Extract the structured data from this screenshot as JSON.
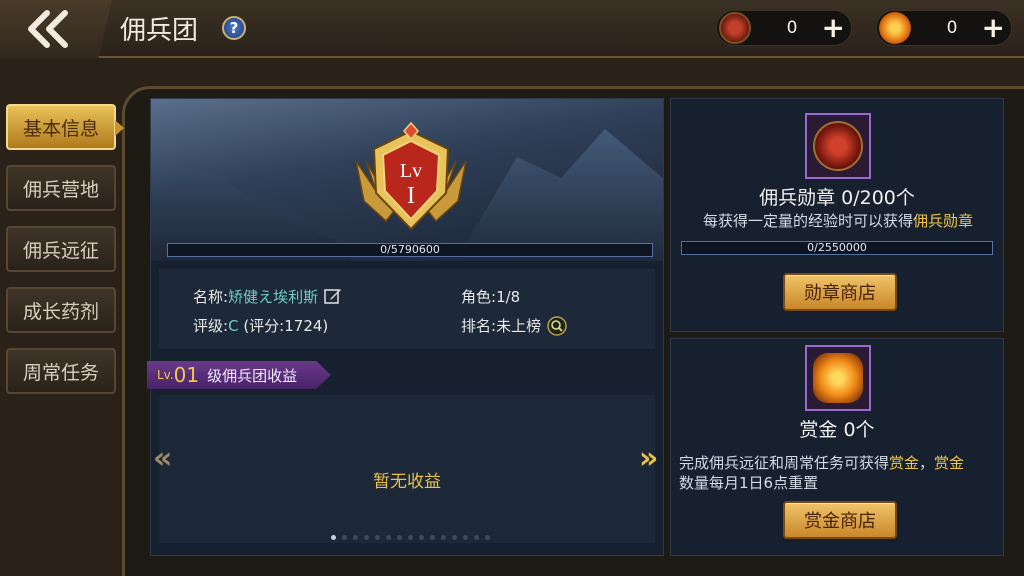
{
  "header": {
    "title": "佣兵团",
    "help_icon": "?",
    "currencies": [
      {
        "icon": "medal-icon",
        "value": "0",
        "plus": "+"
      },
      {
        "icon": "bounty-gem-icon",
        "value": "0",
        "plus": "+"
      }
    ]
  },
  "sidebar": {
    "items": [
      {
        "label": "基本信息",
        "active": true
      },
      {
        "label": "佣兵营地",
        "active": false
      },
      {
        "label": "佣兵远征",
        "active": false
      },
      {
        "label": "成长药剂",
        "active": false
      },
      {
        "label": "周常任务",
        "active": false
      }
    ]
  },
  "legion": {
    "emblem_lv_label": "Lv",
    "emblem_level": "I",
    "exp_text": "0/5790600",
    "name_label": "名称:",
    "name_value": "矫健え埃利斯",
    "grade_label": "评级:",
    "grade_value": "C",
    "grade_score": "(评分:1724)",
    "role_label": "角色:",
    "role_value": "1/8",
    "rank_label": "排名:",
    "rank_value": "未上榜",
    "income_lv_prefix": "Lv.",
    "income_lv_num": "01",
    "income_title": "级佣兵团收益",
    "no_income": "暂无收益",
    "arrow_left": "«",
    "arrow_right": "»"
  },
  "medal": {
    "title": "佣兵勋章 0/200个",
    "desc_prefix": "每获得一定量的经验时可以获得",
    "desc_highlight": "佣兵勋章",
    "progress_text": "0/2550000",
    "button": "勋章商店"
  },
  "bounty": {
    "title": "赏金 0个",
    "desc_1": "完成佣兵远征和周常任务可获得",
    "desc_hl1": "赏金",
    "desc_2": "，",
    "desc_hl2": "赏金",
    "desc_3": "数量每月1日6点重置",
    "button": "赏金商店"
  },
  "colors": {
    "accent_gold": "#f3c64a",
    "teal_value": "#6fd0c0",
    "purple_tab": "#6a3a8a"
  }
}
